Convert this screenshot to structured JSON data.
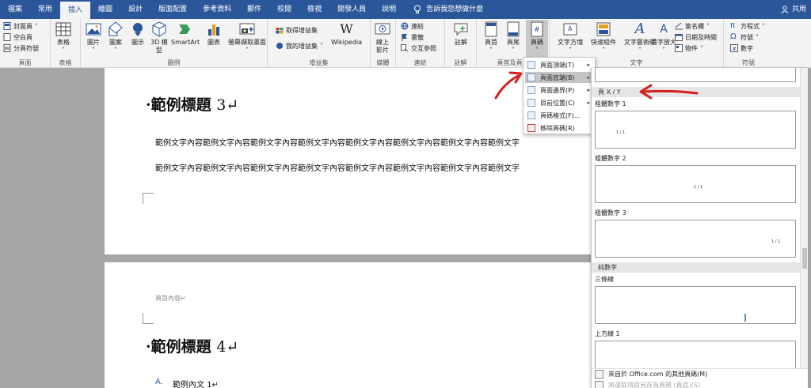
{
  "tabs": [
    "檔案",
    "常用",
    "插入",
    "繪圖",
    "設計",
    "版面配置",
    "參考資料",
    "郵件",
    "校閱",
    "檢視",
    "開發人員",
    "說明"
  ],
  "active_tab": "插入",
  "tell_me": "告訴我您想做什麼",
  "share": "共用",
  "ribbon": {
    "pages": {
      "cover": "封面頁",
      "blank": "空白頁",
      "break": "分頁符號",
      "label": "頁面"
    },
    "table": {
      "btn": "表格",
      "label": "表格"
    },
    "illustrations": {
      "picture": "圖片",
      "shapes": "圖案",
      "icons": "圖示",
      "model3d_1": "3D 模",
      "model3d_2": "型",
      "smartart": "SmartArt",
      "chart": "圖表",
      "screenshot": "螢幕擷取畫面",
      "label": "圖例"
    },
    "addins": {
      "get": "取得增益集",
      "my": "我的增益集",
      "wikipedia": "Wikipedia",
      "label": "增益集"
    },
    "media": {
      "video1": "線上",
      "video2": "影片",
      "label": "媒體"
    },
    "links": {
      "link": "連結",
      "bookmark": "書籤",
      "cross": "交互參照",
      "label": "連結"
    },
    "comments": {
      "btn": "註解",
      "label": "註解"
    },
    "header_footer": {
      "header": "頁首",
      "footer": "頁尾",
      "pagenum": "頁碼",
      "label": "頁首及頁尾"
    },
    "text": {
      "textbox": "文字方塊",
      "quickparts": "快速組件",
      "wordart": "文字藝術師",
      "dropcap": "首字放大",
      "signature": "簽名欄",
      "datetime": "日期及時間",
      "object": "物件",
      "label": "文字"
    },
    "symbols": {
      "equation": "方程式",
      "symbol": "符號",
      "number": "數字",
      "label": "符號"
    }
  },
  "document": {
    "heading3_dot": "·",
    "heading3_text": "範例標題",
    "heading3_num": "3",
    "mark": "↵",
    "body_line1": "範例文字內容範例文字內容範例文字內容範例文字內容範例文字內容範例文字內容範例文字內容範例文字",
    "body_line2": "範例文字內容範例文字內容範例文字內容範例文字內容範例文字內容範例文字內容範例文字內容範例文字",
    "header_content": "頁首內容↵",
    "heading4_dot": "·",
    "heading4_text": "範例標題",
    "heading4_num": "4",
    "list_marker": "A.",
    "list_item": "範例內文 1↵"
  },
  "menu": [
    {
      "label": "頁面頂端(T)",
      "arrow": "▸"
    },
    {
      "label": "頁面底端(B)",
      "arrow": "▸"
    },
    {
      "label": "頁面邊界(P)",
      "arrow": "▸"
    },
    {
      "label": "目前位置(C)",
      "arrow": "▸"
    },
    {
      "label": "頁碼格式(F)..."
    },
    {
      "label": "移除頁碼(R)"
    }
  ],
  "gallery": {
    "category1": "頁 X / Y",
    "item1": "粗體數字 1",
    "item2": "粗體數字 2",
    "item3": "粗體數字 3",
    "category2": "純數字",
    "item4": "三條線",
    "item5": "上方線 1",
    "thumb_num": "1 / 1",
    "footer1": "來自於 Office.com 的其他頁碼(M)",
    "footer2": "將選取項目另存為頁碼 (頁底)(S)"
  },
  "colors": {
    "ribbon_tab": "#2b579a",
    "annotation": "#d42020"
  }
}
